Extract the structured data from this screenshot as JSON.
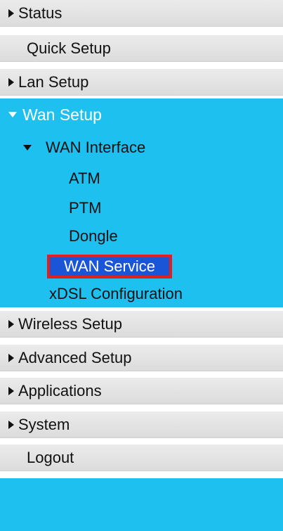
{
  "menu": {
    "status": "Status",
    "quick_setup": "Quick Setup",
    "lan_setup": "Lan Setup",
    "wan_setup": "Wan Setup",
    "wan_interface": "WAN Interface",
    "atm": "ATM",
    "ptm": "PTM",
    "dongle": "Dongle",
    "wan_service": "WAN Service",
    "xdsl_configuration": "xDSL Configuration",
    "wireless_setup": "Wireless Setup",
    "advanced_setup": "Advanced Setup",
    "applications": "Applications",
    "system": "System",
    "logout": "Logout"
  },
  "colors": {
    "active_section_bg": "#1ec0f0",
    "selected_item_bg": "#1a55d8",
    "selected_item_border": "#e02020",
    "menu_row_bg": "#dcdcdc"
  }
}
